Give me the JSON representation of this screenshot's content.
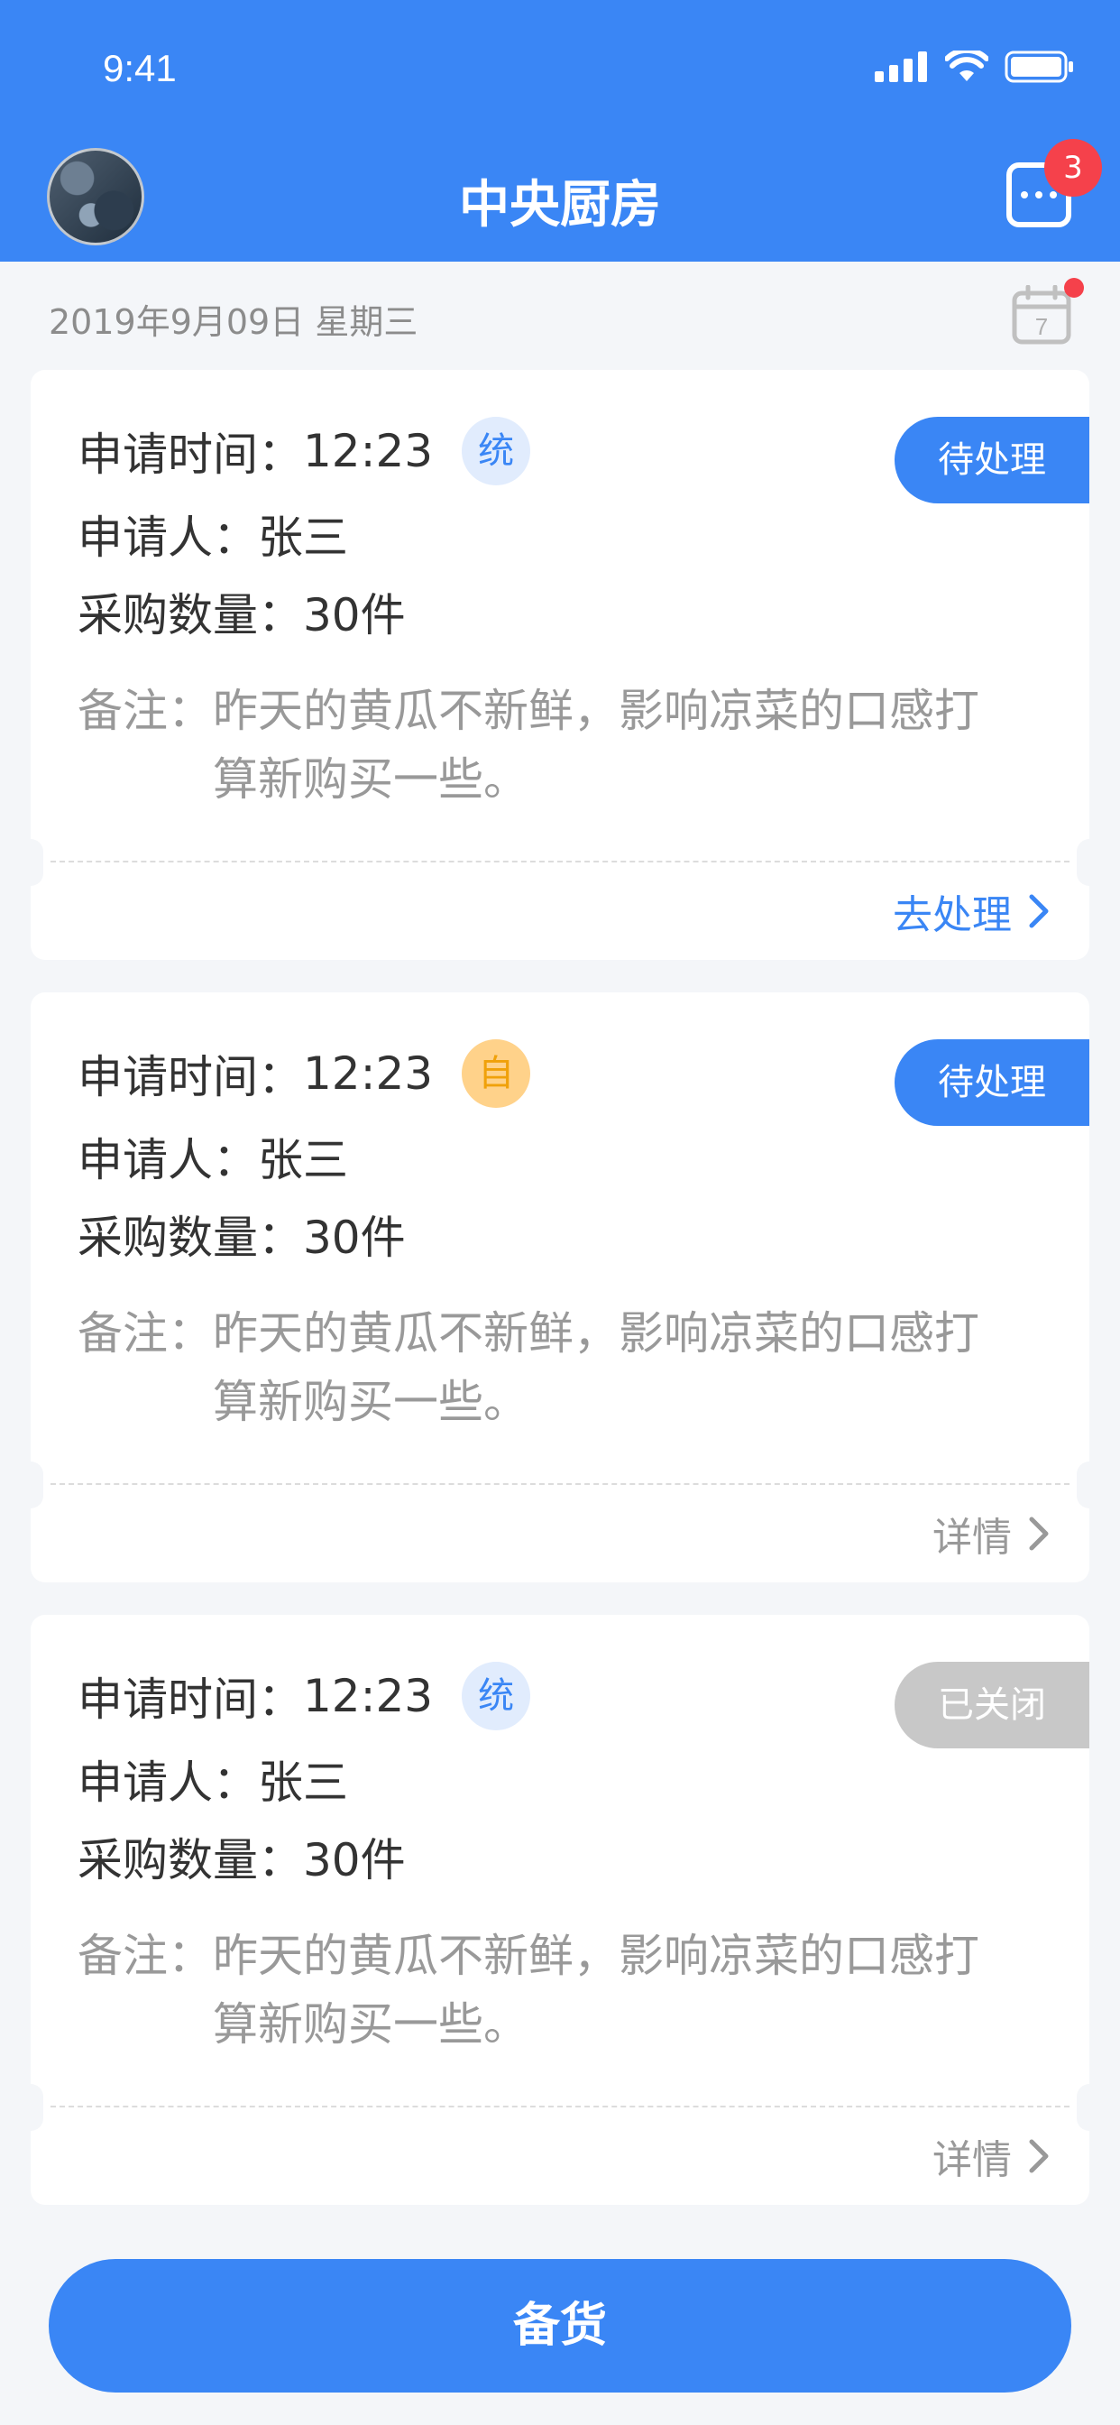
{
  "status_bar": {
    "time": "9:41"
  },
  "header": {
    "title": "中央厨房",
    "message_badge": "3"
  },
  "date_text": "2019年9月09日 星期三",
  "calendar_day": "7",
  "labels": {
    "apply_time": "申请时间：",
    "applicant": "申请人：",
    "quantity": "采购数量：",
    "note": "备注："
  },
  "cards": [
    {
      "time": "12:23",
      "type": "统",
      "applicant": "张三",
      "quantity": "30件",
      "note": "昨天的黄瓜不新鲜，影响凉菜的口感打算新购买一些。",
      "status": "待处理",
      "action": "去处理"
    },
    {
      "time": "12:23",
      "type": "自",
      "applicant": "张三",
      "quantity": "30件",
      "note": "昨天的黄瓜不新鲜，影响凉菜的口感打算新购买一些。",
      "status": "待处理",
      "action": "详情"
    },
    {
      "time": "12:23",
      "type": "统",
      "applicant": "张三",
      "quantity": "30件",
      "note": "昨天的黄瓜不新鲜，影响凉菜的口感打算新购买一些。",
      "status": "已关闭",
      "action": "详情"
    }
  ],
  "bottom_button": "备货",
  "colors": {
    "primary": "#3a86f5",
    "badge_red": "#f5414b",
    "closed_gray": "#c8c8c8",
    "self_orange": "#ffd28a"
  },
  "icons": [
    "avatar",
    "message-icon",
    "calendar-icon",
    "chevron-right-icon",
    "signal-icon",
    "wifi-icon",
    "battery-icon"
  ]
}
